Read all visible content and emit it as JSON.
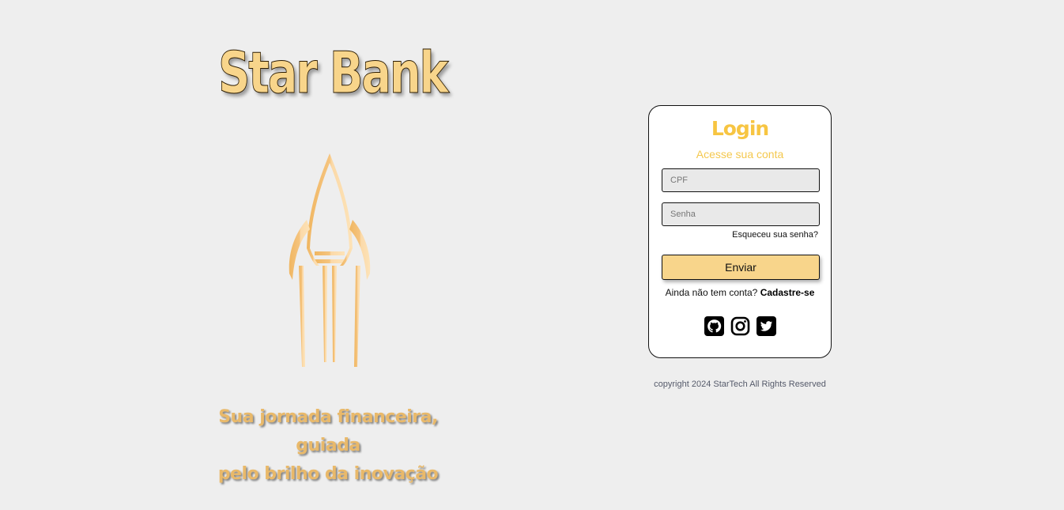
{
  "brand": {
    "title": "Star Bank",
    "tagline_line1": "Sua jornada financeira, guiada",
    "tagline_line2": "pelo brilho da inovação",
    "logo_icon": "rocket-icon"
  },
  "login": {
    "title": "Login",
    "subtitle": "Acesse sua conta",
    "cpf_placeholder": "CPF",
    "cpf_value": "",
    "password_placeholder": "Senha",
    "password_value": "",
    "forgot_label": "Esqueceu sua senha?",
    "submit_label": "Enviar",
    "signup_prompt": "Ainda não tem conta?",
    "signup_label": "Cadastre-se",
    "social_icons": [
      "github-icon",
      "instagram-icon",
      "twitter-icon"
    ]
  },
  "footer": {
    "copyright": "copyright 2024 StarTech All Rights Reserved"
  },
  "colors": {
    "background": "#eeeeee",
    "brand_gold": "#f8d58b",
    "title_yellow": "#f7c542",
    "tagline_gold": "#e9b96a",
    "rocket_dark": "#f0b661",
    "rocket_light": "#fde3b8"
  }
}
